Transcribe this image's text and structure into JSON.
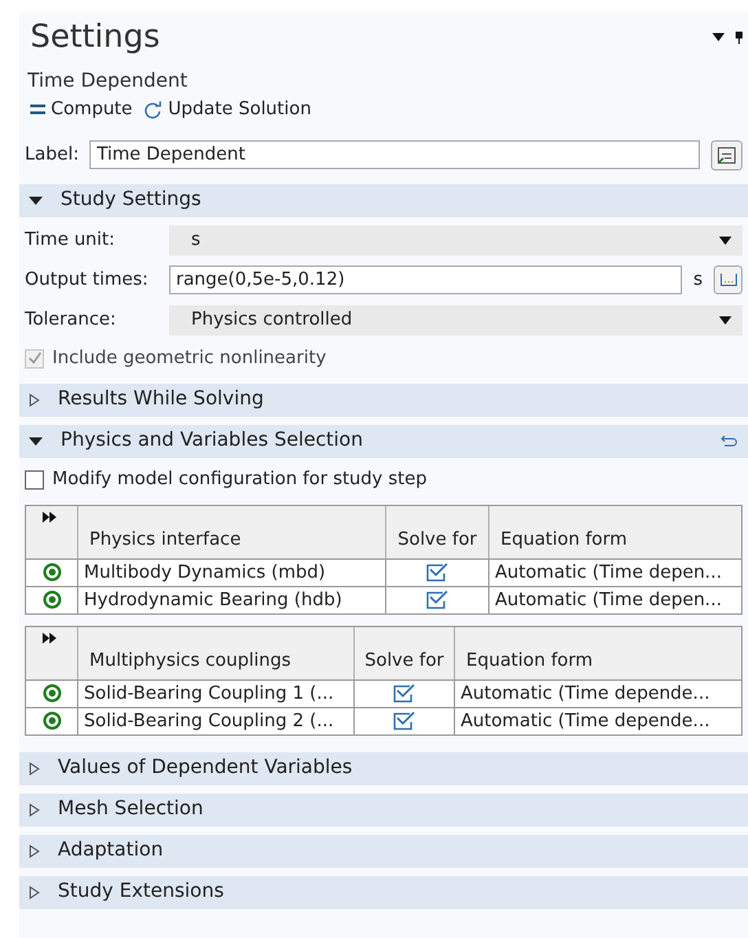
{
  "panel": {
    "title": "Settings",
    "subtitle": "Time Dependent"
  },
  "toolbar": [
    {
      "kind": "compute",
      "label": "Compute"
    },
    {
      "kind": "update",
      "label": "Update Solution"
    }
  ],
  "label_field": {
    "label": "Label:",
    "value": "Time Dependent"
  },
  "sections": [
    {
      "title": "Study Settings",
      "expanded": true,
      "fields": [
        {
          "kind": "select",
          "label": "Time unit:",
          "value": "s"
        },
        {
          "kind": "text",
          "label": "Output times:",
          "value": "range(0,5e-5,0.12)",
          "unit": "s"
        },
        {
          "kind": "select",
          "label": "Tolerance:",
          "value": "Physics controlled"
        }
      ],
      "checkbox": {
        "label": "Include geometric nonlinearity",
        "checked": true,
        "disabled": true
      }
    },
    {
      "title": "Results While Solving",
      "expanded": false
    },
    {
      "title": "Physics and Variables Selection",
      "expanded": true,
      "checkbox": {
        "label": "Modify model configuration for study step",
        "checked": false,
        "disabled": false
      },
      "tables": [
        {
          "columns": [
            "Physics interface",
            "Solve for",
            "Equation form"
          ],
          "rows": [
            {
              "active": true,
              "name": "Multibody Dynamics (mbd)",
              "solve_for": true,
              "form": "Automatic (Time depen..."
            },
            {
              "active": true,
              "name": "Hydrodynamic Bearing (hdb)",
              "solve_for": true,
              "form": "Automatic (Time depen..."
            }
          ]
        },
        {
          "columns": [
            "Multiphysics couplings",
            "Solve for",
            "Equation form"
          ],
          "rows": [
            {
              "active": true,
              "name": "Solid-Bearing Coupling 1 (...",
              "solve_for": true,
              "form": "Automatic (Time depende..."
            },
            {
              "active": true,
              "name": "Solid-Bearing Coupling 2 (...",
              "solve_for": true,
              "form": "Automatic (Time depende..."
            }
          ]
        }
      ]
    },
    {
      "title": "Values of Dependent Variables",
      "expanded": false
    },
    {
      "title": "Mesh Selection",
      "expanded": false
    },
    {
      "title": "Adaptation",
      "expanded": false
    },
    {
      "title": "Study Extensions",
      "expanded": false
    }
  ]
}
